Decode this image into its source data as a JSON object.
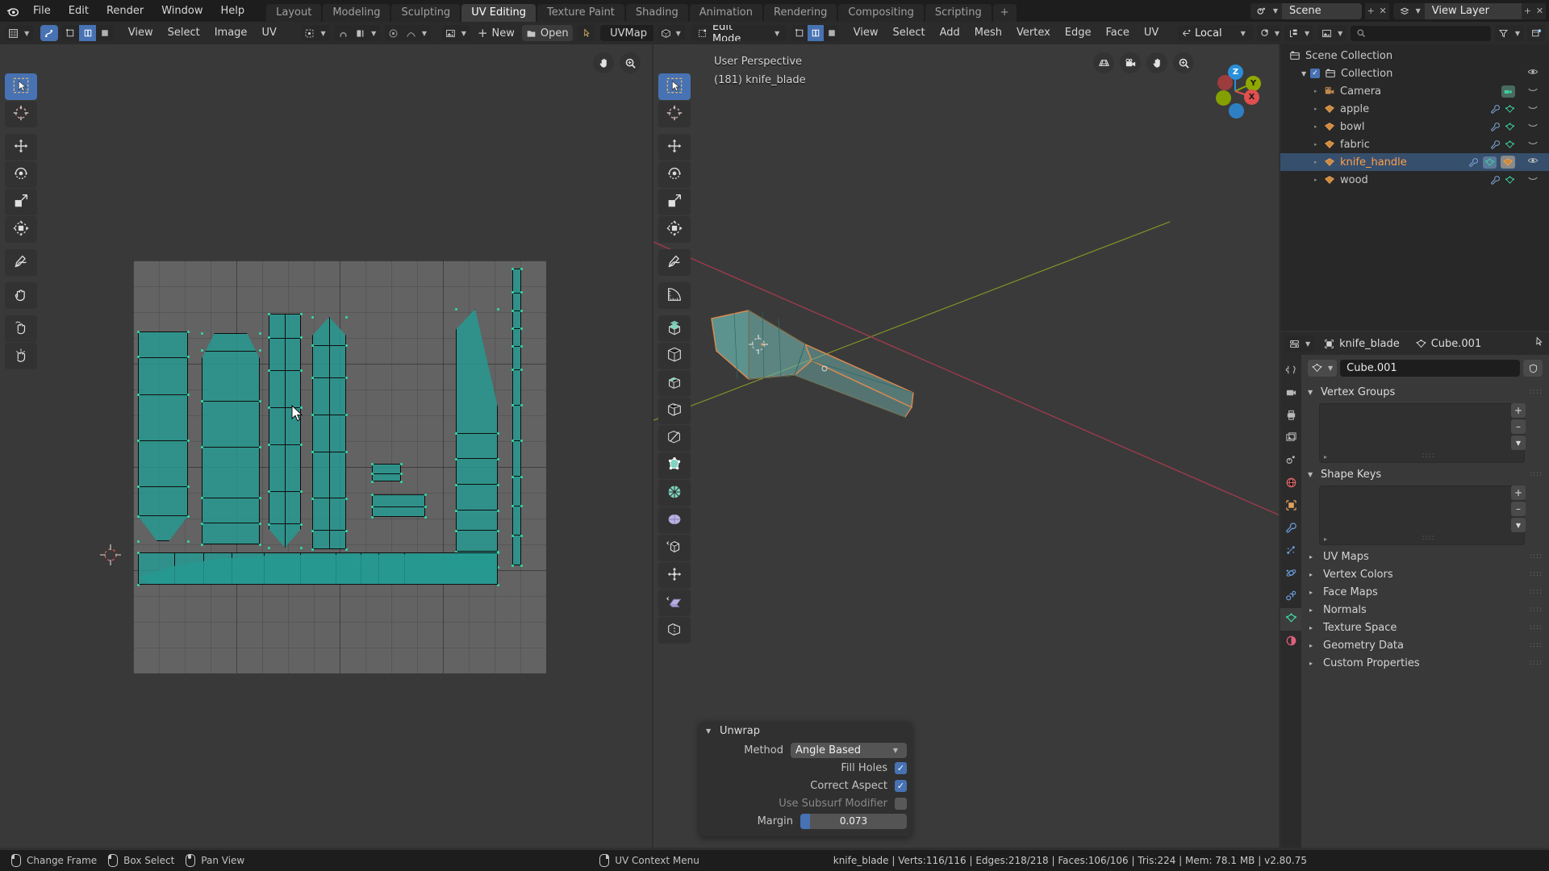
{
  "topbar": {
    "logo_icon": "blender-logo-icon",
    "menus": [
      "File",
      "Edit",
      "Render",
      "Window",
      "Help"
    ],
    "workspaces": [
      {
        "label": "Layout",
        "active": false
      },
      {
        "label": "Modeling",
        "active": false
      },
      {
        "label": "Sculpting",
        "active": false
      },
      {
        "label": "UV Editing",
        "active": true
      },
      {
        "label": "Texture Paint",
        "active": false
      },
      {
        "label": "Shading",
        "active": false
      },
      {
        "label": "Animation",
        "active": false
      },
      {
        "label": "Rendering",
        "active": false
      },
      {
        "label": "Compositing",
        "active": false
      },
      {
        "label": "Scripting",
        "active": false
      }
    ],
    "add_workspace_label": "+",
    "scene_name": "Scene",
    "view_layer_name": "View Layer",
    "scene_icon": "scene-icon",
    "viewlayer_icon": "view-layer-icon"
  },
  "uv_editor": {
    "header": {
      "editor_type_icon": "uv-editor-icon",
      "mode_icon": "uv-sync-icon",
      "select_modes": [
        "vertex-select-icon",
        "edge-select-icon",
        "face-select-icon",
        "island-select-icon"
      ],
      "menus": [
        "View",
        "Select",
        "Image",
        "UV"
      ],
      "pivot_icon": "pivot-point-icon",
      "snap_icon": "snap-magnet-icon",
      "snap_target_icon": "snap-target-icon",
      "proportional_icon": "proportional-edit-icon",
      "falloff_icon": "falloff-curve-icon",
      "image_browse_icon": "image-browse-icon",
      "new_label": "New",
      "open_label": "Open",
      "pin_icon": "pin-icon",
      "uvmap_label": "UVMap"
    },
    "toolbar": [
      {
        "name": "tweak-tool",
        "icon": "cursor-select-icon",
        "active": true
      },
      {
        "name": "cursor-tool",
        "icon": "3d-cursor-icon",
        "active": false
      },
      {
        "name": "move-tool",
        "icon": "move-arrows-icon",
        "active": false
      },
      {
        "name": "rotate-tool",
        "icon": "rotate-icon",
        "active": false
      },
      {
        "name": "scale-tool",
        "icon": "scale-icon",
        "active": false
      },
      {
        "name": "transform-tool",
        "icon": "transform-icon",
        "active": false
      },
      {
        "name": "annotate-tool",
        "icon": "pencil-icon",
        "active": false
      },
      {
        "name": "grab-uv-tool",
        "icon": "grab-hand-icon",
        "active": false
      },
      {
        "name": "relax-uv-tool",
        "icon": "relax-hand-icon",
        "active": false
      },
      {
        "name": "pinch-uv-tool",
        "icon": "pinch-hand-icon",
        "active": false
      }
    ],
    "overlay_buttons": [
      "pan-view-icon",
      "zoom-view-icon"
    ],
    "cursor_icon": "2d-cursor-icon"
  },
  "viewport": {
    "header": {
      "editor_type_icon": "3d-viewport-icon",
      "mode_icon": "edit-mode-icon",
      "mode_label": "Edit Mode",
      "select_modes": [
        "vertex-select-icon",
        "edge-select-icon",
        "face-select-icon"
      ],
      "active_select_mode": 1,
      "menus": [
        "View",
        "Select",
        "Add",
        "Mesh",
        "Vertex",
        "Edge",
        "Face",
        "UV"
      ],
      "orientation_icon": "orientation-icon",
      "orientation_label": "Local",
      "snap_icon": "snap-magnet-icon",
      "proportional_icon": "proportional-edit-icon"
    },
    "overlay": {
      "perspective_label": "User Perspective",
      "object_label": "(181) knife_blade"
    },
    "gizmo_buttons": [
      "grid-view-icon",
      "camera-view-icon",
      "pan-view-icon",
      "zoom-view-icon"
    ],
    "axis_gizmo": {
      "axes": [
        {
          "label": "Z",
          "color": "#2a8fd8",
          "positive": true
        },
        {
          "label": "Y",
          "color": "#90a800",
          "positive": true
        },
        {
          "label": "X",
          "color": "#e0504f",
          "positive": true
        },
        {
          "label": "",
          "color": "#2a8fd8",
          "positive": false
        },
        {
          "label": "",
          "color": "#90a800",
          "positive": false
        },
        {
          "label": "",
          "color": "#9c3c3c",
          "positive": false
        }
      ]
    },
    "toolbar": [
      {
        "name": "tweak-tool",
        "icon": "cursor-select-icon",
        "active": true
      },
      {
        "name": "cursor-tool",
        "icon": "3d-cursor-icon",
        "active": false
      },
      {
        "name": "move-tool",
        "icon": "move-arrows-icon",
        "active": false
      },
      {
        "name": "rotate-tool",
        "icon": "rotate-icon",
        "active": false
      },
      {
        "name": "scale-tool",
        "icon": "scale-icon",
        "active": false
      },
      {
        "name": "transform-tool",
        "icon": "transform-icon",
        "active": false
      },
      {
        "name": "annotate-tool",
        "icon": "pencil-icon",
        "active": false
      },
      {
        "name": "measure-tool",
        "icon": "ruler-icon",
        "active": false
      },
      {
        "name": "extrude-region-tool",
        "icon": "extrude-icon",
        "active": false
      },
      {
        "name": "inset-faces-tool",
        "icon": "inset-icon",
        "active": false
      },
      {
        "name": "bevel-tool",
        "icon": "bevel-icon",
        "active": false
      },
      {
        "name": "loop-cut-tool",
        "icon": "loop-cut-icon",
        "active": false
      },
      {
        "name": "knife-tool",
        "icon": "knife-icon",
        "active": false
      },
      {
        "name": "poly-build-tool",
        "icon": "poly-build-icon",
        "active": false
      },
      {
        "name": "spin-tool",
        "icon": "spin-icon",
        "active": false
      },
      {
        "name": "smooth-tool",
        "icon": "smooth-icon",
        "active": false
      },
      {
        "name": "edge-slide-tool",
        "icon": "edge-slide-icon",
        "active": false
      },
      {
        "name": "shrink-fatten-tool",
        "icon": "shrink-fatten-icon",
        "active": false
      },
      {
        "name": "shear-tool",
        "icon": "shear-icon",
        "active": false
      },
      {
        "name": "rip-region-tool",
        "icon": "rip-region-icon",
        "active": false
      }
    ],
    "operator_panel": {
      "title": "Unwrap",
      "method_label": "Method",
      "method_value": "Angle Based",
      "fill_holes_label": "Fill Holes",
      "fill_holes_checked": true,
      "correct_aspect_label": "Correct Aspect",
      "correct_aspect_checked": true,
      "use_subsurf_label": "Use Subsurf Modifier",
      "use_subsurf_checked": false,
      "margin_label": "Margin",
      "margin_value": "0.073"
    }
  },
  "outliner": {
    "display_mode_icon": "outliner-display-icon",
    "filter_id_icon": "filter-id-icon",
    "search_placeholder": "",
    "search_icon": "search-icon",
    "filter_icon": "filter-funnel-icon",
    "new_collection_icon": "new-collection-icon",
    "rows": [
      {
        "label": "Scene Collection",
        "icon": "collection-icon",
        "indent": 0,
        "selected": false,
        "has_tri": false,
        "has_check": false,
        "eye": false,
        "icons": []
      },
      {
        "label": "Collection",
        "icon": "collection-icon",
        "indent": 1,
        "selected": false,
        "has_tri": true,
        "has_check": true,
        "eye": true,
        "icons": []
      },
      {
        "label": "Camera",
        "icon": "camera-object-icon",
        "indent": 2,
        "selected": false,
        "has_tri": true,
        "has_check": false,
        "eye": false,
        "icons": [
          "camera-data-icon"
        ]
      },
      {
        "label": "apple",
        "icon": "mesh-object-icon",
        "indent": 2,
        "selected": false,
        "has_tri": true,
        "has_check": false,
        "eye": false,
        "icons": [
          "modifier-icon",
          "mesh-data-icon"
        ]
      },
      {
        "label": "bowl",
        "icon": "mesh-object-icon",
        "indent": 2,
        "selected": false,
        "has_tri": true,
        "has_check": false,
        "eye": false,
        "icons": [
          "modifier-icon",
          "mesh-data-icon"
        ]
      },
      {
        "label": "fabric",
        "icon": "mesh-object-icon",
        "indent": 2,
        "selected": false,
        "has_tri": true,
        "has_check": false,
        "eye": false,
        "icons": [
          "modifier-icon",
          "mesh-data-icon"
        ]
      },
      {
        "label": "knife_handle",
        "icon": "mesh-object-icon",
        "indent": 2,
        "selected": true,
        "has_tri": true,
        "has_check": false,
        "eye": true,
        "icons": [
          "modifier-icon",
          "mesh-data-icon",
          "mesh-object-icon"
        ]
      },
      {
        "label": "wood",
        "icon": "mesh-object-icon",
        "indent": 2,
        "selected": false,
        "has_tri": true,
        "has_check": false,
        "eye": false,
        "icons": [
          "modifier-icon",
          "mesh-data-icon"
        ]
      }
    ]
  },
  "properties": {
    "editor_icon": "properties-editor-icon",
    "breadcrumb": [
      {
        "label": "knife_blade",
        "icon": "object-icon"
      },
      {
        "label": "Cube.001",
        "icon": "mesh-data-icon"
      }
    ],
    "pin_icon": "pin-icon",
    "tabs": [
      {
        "name": "tool-tab",
        "icon": "tool-icon",
        "active": false,
        "color": "#b8b8b8"
      },
      {
        "name": "render-tab",
        "icon": "render-camera-icon",
        "active": false,
        "color": "#b8b8b8"
      },
      {
        "name": "output-tab",
        "icon": "printer-icon",
        "active": false,
        "color": "#b8b8b8"
      },
      {
        "name": "view-layer-tab",
        "icon": "images-icon",
        "active": false,
        "color": "#b8b8b8"
      },
      {
        "name": "scene-tab",
        "icon": "scene-cone-icon",
        "active": false,
        "color": "#b8b8b8"
      },
      {
        "name": "world-tab",
        "icon": "world-globe-icon",
        "active": false,
        "color": "#e06666"
      },
      {
        "name": "object-tab",
        "icon": "object-square-icon",
        "active": false,
        "color": "#e0a060"
      },
      {
        "name": "modifier-tab",
        "icon": "wrench-icon",
        "active": false,
        "color": "#6a9ee0"
      },
      {
        "name": "particles-tab",
        "icon": "particles-icon",
        "active": false,
        "color": "#6a9ee0"
      },
      {
        "name": "physics-tab",
        "icon": "physics-orbit-icon",
        "active": false,
        "color": "#6a9ee0"
      },
      {
        "name": "constraints-tab",
        "icon": "constraint-icon",
        "active": false,
        "color": "#6a9ee0"
      },
      {
        "name": "data-tab",
        "icon": "mesh-data-icon",
        "active": true,
        "color": "#3ecf9a"
      },
      {
        "name": "material-tab",
        "icon": "material-sphere-icon",
        "active": false,
        "color": "#e0607f"
      }
    ],
    "datablock_icon": "mesh-data-icon",
    "datablock_name": "Cube.001",
    "shield_icon": "fake-user-shield-icon",
    "panels": [
      {
        "label": "Vertex Groups",
        "open": true,
        "has_list": true
      },
      {
        "label": "Shape Keys",
        "open": true,
        "has_list": true
      },
      {
        "label": "UV Maps",
        "open": false,
        "has_list": false
      },
      {
        "label": "Vertex Colors",
        "open": false,
        "has_list": false
      },
      {
        "label": "Face Maps",
        "open": false,
        "has_list": false
      },
      {
        "label": "Normals",
        "open": false,
        "has_list": false
      },
      {
        "label": "Texture Space",
        "open": false,
        "has_list": false
      },
      {
        "label": "Geometry Data",
        "open": false,
        "has_list": false
      },
      {
        "label": "Custom Properties",
        "open": false,
        "has_list": false
      }
    ],
    "list_add_label": "+",
    "list_remove_label": "–",
    "list_menu_icon": "chevron-down-icon"
  },
  "status_bar": {
    "hints": [
      {
        "mouse": "left",
        "label": "Change Frame"
      },
      {
        "mouse": "leftdrag",
        "label": "Box Select"
      },
      {
        "mouse": "middle",
        "label": "Pan View"
      },
      {
        "mouse": "right",
        "label": "UV Context Menu"
      }
    ],
    "stats": "knife_blade | Verts:116/116 | Edges:218/218 | Faces:106/106 | Tris:224 | Mem: 78.1 MB | v2.80.75"
  },
  "colors": {
    "accent_blue": "#4772b3",
    "uv_face": "#269990",
    "uv_vertex": "#2ee0a8",
    "select_orange": "#ff9f4a",
    "mesh_green": "#3ecf9a"
  }
}
